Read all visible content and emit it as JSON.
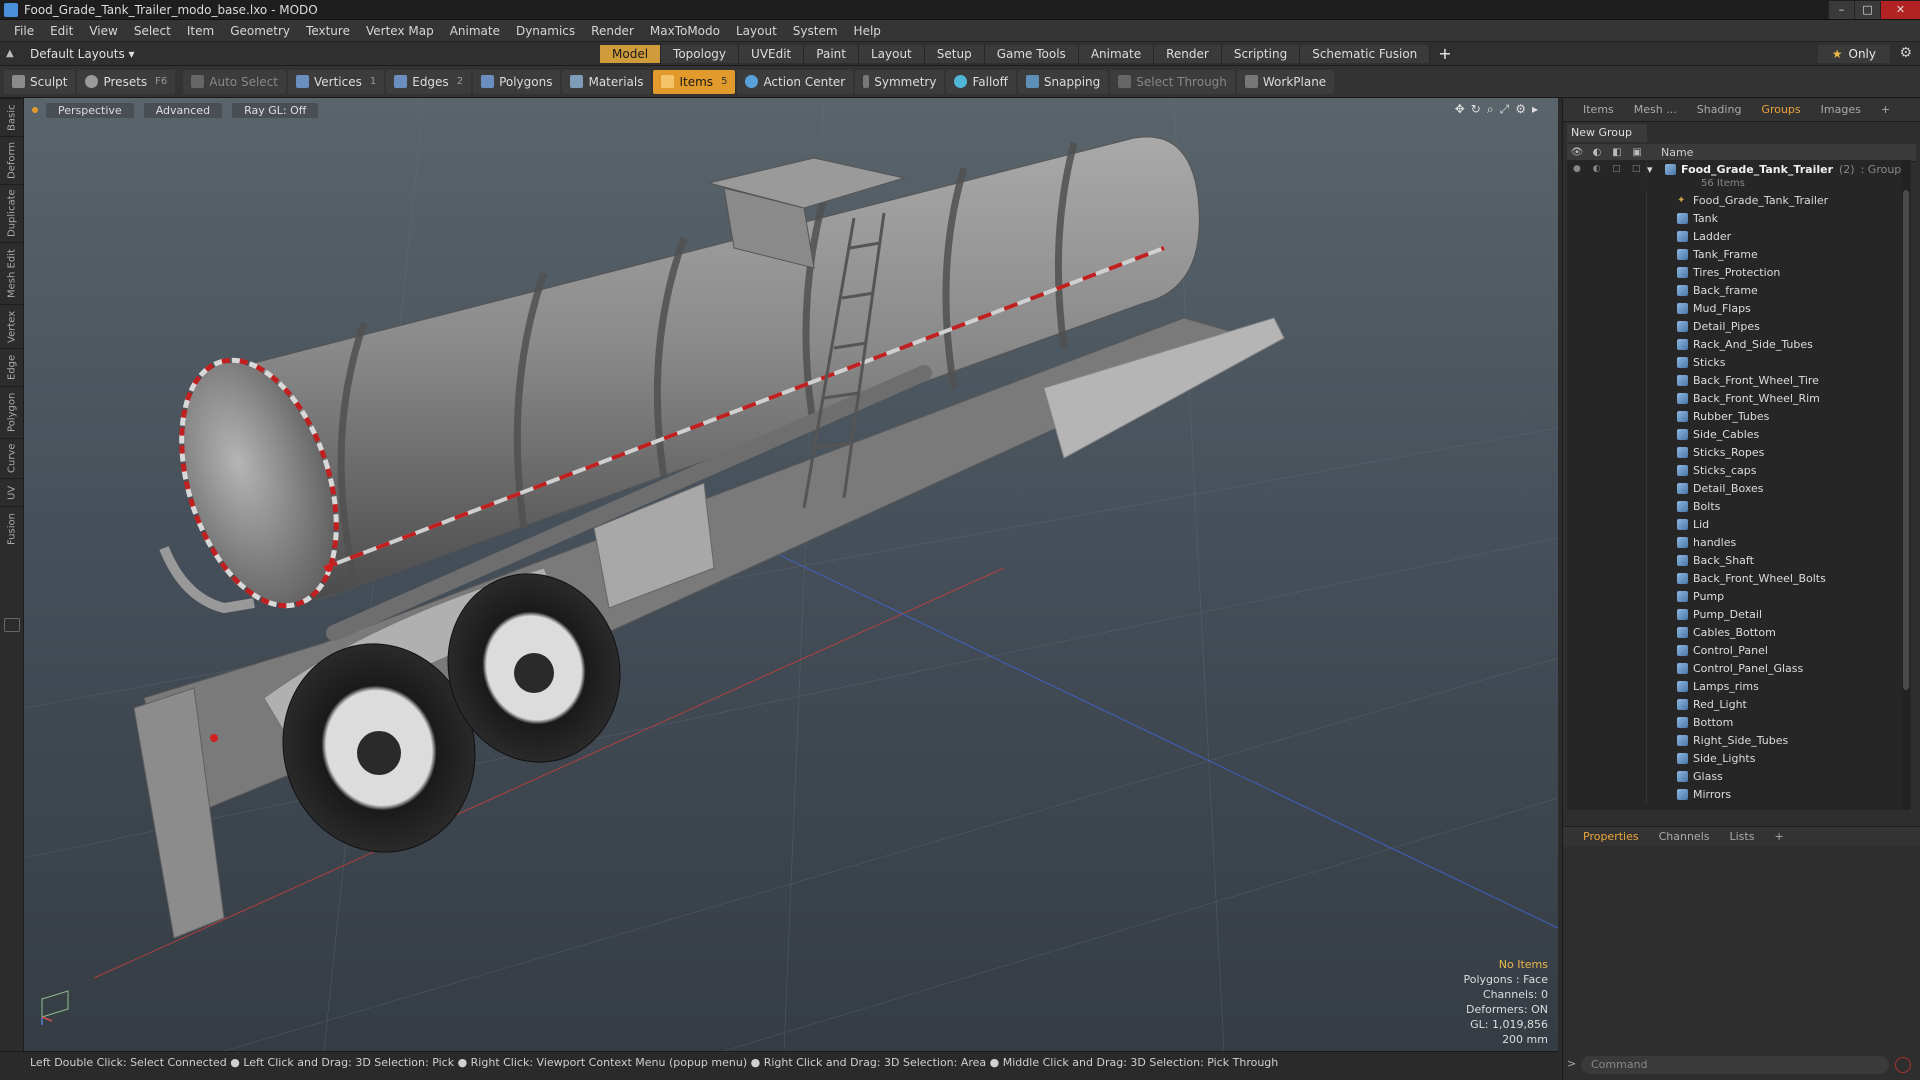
{
  "window": {
    "title": "Food_Grade_Tank_Trailer_modo_base.lxo - MODO",
    "minimize": "–",
    "maximize": "□",
    "close": "✕"
  },
  "menu": [
    "File",
    "Edit",
    "View",
    "Select",
    "Item",
    "Geometry",
    "Texture",
    "Vertex Map",
    "Animate",
    "Dynamics",
    "Render",
    "MaxToModo",
    "Layout",
    "System",
    "Help"
  ],
  "layout": {
    "selector": "Default Layouts ▾",
    "tabs": [
      "Model",
      "Topology",
      "UVEdit",
      "Paint",
      "Layout",
      "Setup",
      "Game Tools",
      "Animate",
      "Render",
      "Scripting",
      "Schematic Fusion"
    ],
    "active_tab": "Model",
    "add": "+",
    "only": "Only"
  },
  "toolbar": {
    "sculpt": "Sculpt",
    "presets": "Presets",
    "presets_key": "F6",
    "auto_select": "Auto Select",
    "vertices": "Vertices",
    "vertices_key": "1",
    "edges": "Edges",
    "edges_key": "2",
    "polygons": "Polygons",
    "materials": "Materials",
    "items": "Items",
    "items_key": "5",
    "action_center": "Action Center",
    "symmetry": "Symmetry",
    "falloff": "Falloff",
    "snapping": "Snapping",
    "select_through": "Select Through",
    "workplane": "WorkPlane"
  },
  "left_tabs": [
    "Basic",
    "Deform",
    "Duplicate",
    "Mesh Edit",
    "Vertex",
    "Edge",
    "Polygon",
    "Curve",
    "UV",
    "Fusion"
  ],
  "viewport": {
    "view": "Perspective",
    "shading": "Advanced",
    "raygl": "Ray GL: Off",
    "info": {
      "items": "No Items",
      "polygons": "Polygons : Face",
      "channels": "Channels: 0",
      "deformers": "Deformers: ON",
      "gl": "GL: 1,019,856",
      "scale": "200 mm"
    }
  },
  "status_bar": "Left Double Click: Select Connected ● Left Click and Drag: 3D Selection: Pick ● Right Click: Viewport Context Menu (popup menu) ● Right Click and Drag: 3D Selection: Area ● Middle Click and Drag: 3D Selection: Pick Through",
  "right_panel": {
    "tabs": [
      "Items",
      "Mesh ...",
      "Shading",
      "Groups",
      "Images",
      "+"
    ],
    "active_tab": "Groups",
    "new_group": "New Group",
    "column_name": "Name",
    "group": {
      "name": "Food_Grade_Tank_Trailer",
      "count": "(2)",
      "type": ": Group",
      "sub": "56 Items"
    },
    "items": [
      "Food_Grade_Tank_Trailer",
      "Tank",
      "Ladder",
      "Tank_Frame",
      "Tires_Protection",
      "Back_frame",
      "Mud_Flaps",
      "Detail_Pipes",
      "Rack_And_Side_Tubes",
      "Sticks",
      "Back_Front_Wheel_Tire",
      "Back_Front_Wheel_Rim",
      "Rubber_Tubes",
      "Side_Cables",
      "Sticks_Ropes",
      "Sticks_caps",
      "Detail_Boxes",
      "Bolts",
      "Lid",
      "handles",
      "Back_Shaft",
      "Back_Front_Wheel_Bolts",
      "Pump",
      "Pump_Detail",
      "Cables_Bottom",
      "Control_Panel",
      "Control_Panel_Glass",
      "Lamps_rims",
      "Red_Light",
      "Bottom",
      "Right_Side_Tubes",
      "Side_Lights",
      "Glass",
      "Mirrors"
    ],
    "props_tabs": [
      "Properties",
      "Channels",
      "Lists",
      "+"
    ],
    "command_placeholder": "Command"
  }
}
